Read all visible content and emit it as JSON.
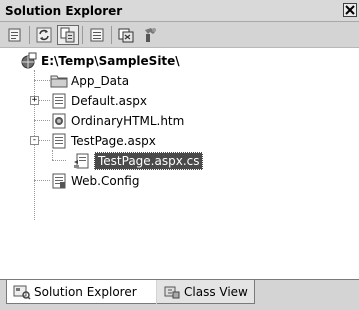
{
  "window": {
    "title": "Solution Explorer"
  },
  "toolbar": {
    "buttons": [
      {
        "icon": "properties-icon"
      },
      {
        "icon": "refresh-icon"
      },
      {
        "icon": "nest-related-files-icon"
      },
      {
        "icon": "view-code-icon"
      },
      {
        "icon": "view-designer-icon"
      },
      {
        "icon": "copy-web-site-icon"
      }
    ]
  },
  "tree": {
    "root": {
      "label": "E:\\Temp\\SampleSite\\",
      "icon": "web-site-icon"
    },
    "items": [
      {
        "label": "App_Data",
        "icon": "folder-icon"
      },
      {
        "label": "Default.aspx",
        "icon": "aspx-page-icon",
        "expander": "+"
      },
      {
        "label": "OrdinaryHTML.htm",
        "icon": "html-page-icon"
      },
      {
        "label": "TestPage.aspx",
        "icon": "aspx-page-icon",
        "expander": "-"
      },
      {
        "label": "TestPage.aspx.cs",
        "icon": "cs-code-file-icon",
        "selected": true
      },
      {
        "label": "Web.Config",
        "icon": "config-file-icon"
      }
    ]
  },
  "tabs": [
    {
      "label": "Solution Explorer",
      "icon": "solution-explorer-icon",
      "active": true
    },
    {
      "label": "Class View",
      "icon": "class-view-icon",
      "active": false
    }
  ]
}
